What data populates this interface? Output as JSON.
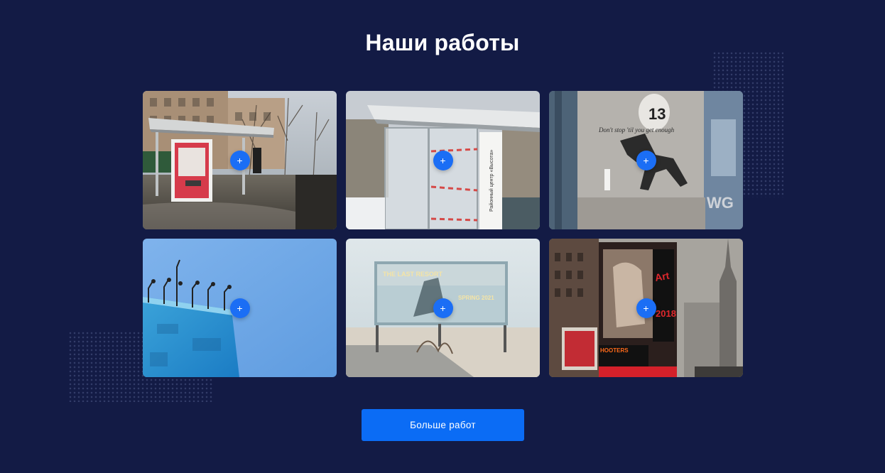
{
  "section": {
    "title": "Наши работы"
  },
  "gallery": {
    "items": [
      {
        "image": "bus-stop-poster-photo",
        "expand_icon": "+"
      },
      {
        "image": "glass-bus-stop-photo",
        "expand_icon": "+"
      },
      {
        "image": "billboard-football-player-photo",
        "expand_icon": "+"
      },
      {
        "image": "blue-billboard-lamps-photo",
        "expand_icon": "+"
      },
      {
        "image": "desert-billboard-photo",
        "expand_icon": "+"
      },
      {
        "image": "times-square-billboards-photo",
        "expand_icon": "+"
      }
    ],
    "photo_texts": {
      "stop2_sign": "Районный центр «Высота»",
      "football_number": "13",
      "football_slogan": "Don't stop 'til you get enough",
      "desert_title": "THE LAST RESORT",
      "desert_subtitle": "SPRING 2021",
      "ts_year": "2018",
      "ts_hooters": "HOOTERS"
    }
  },
  "more_button": {
    "label": "Больше работ"
  },
  "colors": {
    "background": "#131b45",
    "accent": "#0b6cf5",
    "title": "#ffffff"
  }
}
